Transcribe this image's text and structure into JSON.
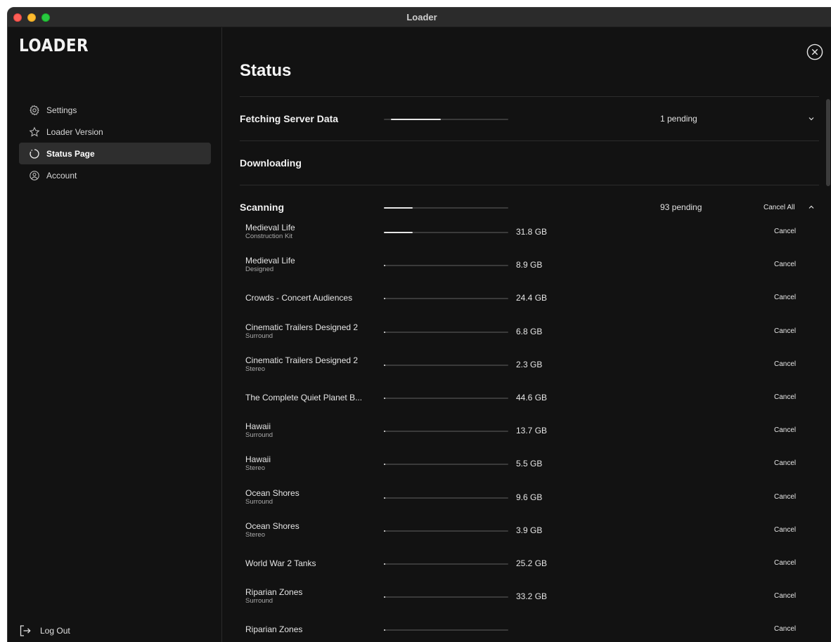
{
  "window": {
    "title": "Loader"
  },
  "sidebar": {
    "logo": "LOADER",
    "items": [
      {
        "label": "Settings",
        "icon": "gear-icon"
      },
      {
        "label": "Loader Version",
        "icon": "star-icon"
      },
      {
        "label": "Status Page",
        "icon": "status-circle-icon",
        "active": true
      },
      {
        "label": "Account",
        "icon": "user-circle-icon"
      }
    ],
    "logout": "Log Out"
  },
  "main": {
    "title": "Status",
    "sections": [
      {
        "title": "Fetching Server Data",
        "pending": "1 pending",
        "progress": 0.4
      },
      {
        "title": "Downloading"
      },
      {
        "title": "Scanning",
        "pending": "93 pending",
        "cancel_all": "Cancel All",
        "progress": 0.23
      }
    ],
    "scan_items": [
      {
        "name": "Medieval Life",
        "sub": "Construction Kit",
        "size": "31.8 GB",
        "progress": 0.23
      },
      {
        "name": "Medieval Life",
        "sub": "Designed",
        "size": "8.9 GB",
        "progress": 0.01
      },
      {
        "name": "Crowds - Concert Audiences",
        "sub": "",
        "size": "24.4 GB",
        "progress": 0.01
      },
      {
        "name": "Cinematic Trailers Designed 2",
        "sub": "Surround",
        "size": "6.8 GB",
        "progress": 0.01
      },
      {
        "name": "Cinematic Trailers Designed 2",
        "sub": "Stereo",
        "size": "2.3 GB",
        "progress": 0.01
      },
      {
        "name": "The Complete Quiet Planet B...",
        "sub": "",
        "size": "44.6 GB",
        "progress": 0.01
      },
      {
        "name": "Hawaii",
        "sub": "Surround",
        "size": "13.7 GB",
        "progress": 0.01
      },
      {
        "name": "Hawaii",
        "sub": "Stereo",
        "size": "5.5 GB",
        "progress": 0.01
      },
      {
        "name": "Ocean Shores",
        "sub": "Surround",
        "size": "9.6 GB",
        "progress": 0.01
      },
      {
        "name": "Ocean Shores",
        "sub": "Stereo",
        "size": "3.9 GB",
        "progress": 0.01
      },
      {
        "name": "World War 2 Tanks",
        "sub": "",
        "size": "25.2 GB",
        "progress": 0.01
      },
      {
        "name": "Riparian Zones",
        "sub": "Surround",
        "size": "33.2 GB",
        "progress": 0.01
      },
      {
        "name": "Riparian Zones",
        "sub": "",
        "size": "",
        "progress": 0.01
      }
    ],
    "cancel_label": "Cancel"
  }
}
